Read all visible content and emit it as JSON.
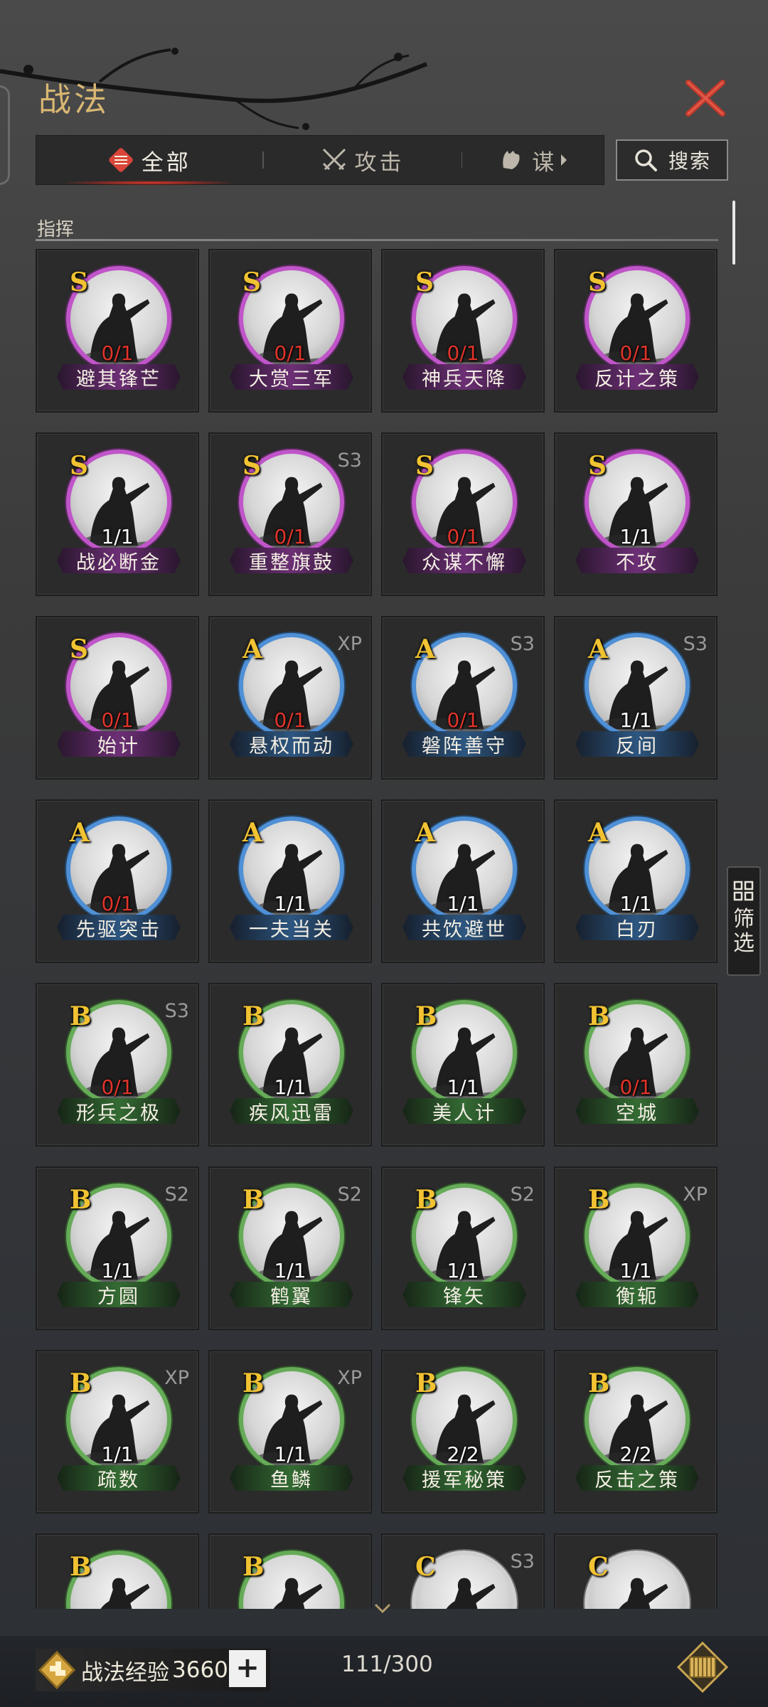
{
  "header": {
    "title": "战法"
  },
  "tabs": [
    {
      "label": "全部",
      "icon": "scroll-icon",
      "active": true
    },
    {
      "label": "攻击",
      "icon": "crossed-swords-icon",
      "active": false
    },
    {
      "label": "谋",
      "icon": "hand-icon",
      "active": false
    }
  ],
  "search": {
    "label": "搜索"
  },
  "section": {
    "label": "指挥"
  },
  "filter": {
    "label": "筛选"
  },
  "colors": {
    "s": "#c055c9",
    "a": "#4f90d6",
    "b": "#66ab58",
    "c": "#cfcfcf",
    "gold": "#d9b772",
    "red": "#e0342a"
  },
  "tactics": [
    {
      "grade": "S",
      "name": "避其锋芒",
      "count": "0/1",
      "tag": ""
    },
    {
      "grade": "S",
      "name": "大赏三军",
      "count": "0/1",
      "tag": ""
    },
    {
      "grade": "S",
      "name": "神兵天降",
      "count": "0/1",
      "tag": ""
    },
    {
      "grade": "S",
      "name": "反计之策",
      "count": "0/1",
      "tag": ""
    },
    {
      "grade": "S",
      "name": "战必断金",
      "count": "1/1",
      "tag": ""
    },
    {
      "grade": "S",
      "name": "重整旗鼓",
      "count": "0/1",
      "tag": "S3"
    },
    {
      "grade": "S",
      "name": "众谋不懈",
      "count": "0/1",
      "tag": ""
    },
    {
      "grade": "S",
      "name": "不攻",
      "count": "1/1",
      "tag": ""
    },
    {
      "grade": "S",
      "name": "始计",
      "count": "0/1",
      "tag": ""
    },
    {
      "grade": "A",
      "name": "悬权而动",
      "count": "0/1",
      "tag": "XP"
    },
    {
      "grade": "A",
      "name": "磐阵善守",
      "count": "0/1",
      "tag": "S3"
    },
    {
      "grade": "A",
      "name": "反间",
      "count": "1/1",
      "tag": "S3"
    },
    {
      "grade": "A",
      "name": "先驱突击",
      "count": "0/1",
      "tag": ""
    },
    {
      "grade": "A",
      "name": "一夫当关",
      "count": "1/1",
      "tag": ""
    },
    {
      "grade": "A",
      "name": "共饮避世",
      "count": "1/1",
      "tag": ""
    },
    {
      "grade": "A",
      "name": "白刃",
      "count": "1/1",
      "tag": ""
    },
    {
      "grade": "B",
      "name": "形兵之极",
      "count": "0/1",
      "tag": "S3"
    },
    {
      "grade": "B",
      "name": "疾风迅雷",
      "count": "1/1",
      "tag": ""
    },
    {
      "grade": "B",
      "name": "美人计",
      "count": "1/1",
      "tag": ""
    },
    {
      "grade": "B",
      "name": "空城",
      "count": "0/1",
      "tag": ""
    },
    {
      "grade": "B",
      "name": "方圆",
      "count": "1/1",
      "tag": "S2"
    },
    {
      "grade": "B",
      "name": "鹤翼",
      "count": "1/1",
      "tag": "S2"
    },
    {
      "grade": "B",
      "name": "锋矢",
      "count": "1/1",
      "tag": "S2"
    },
    {
      "grade": "B",
      "name": "衡轭",
      "count": "1/1",
      "tag": "XP"
    },
    {
      "grade": "B",
      "name": "疏数",
      "count": "1/1",
      "tag": "XP"
    },
    {
      "grade": "B",
      "name": "鱼鳞",
      "count": "1/1",
      "tag": "XP"
    },
    {
      "grade": "B",
      "name": "援军秘策",
      "count": "2/2",
      "tag": ""
    },
    {
      "grade": "B",
      "name": "反击之策",
      "count": "2/2",
      "tag": ""
    },
    {
      "grade": "B",
      "name": "",
      "count": "",
      "tag": ""
    },
    {
      "grade": "B",
      "name": "",
      "count": "",
      "tag": ""
    },
    {
      "grade": "C",
      "name": "",
      "count": "",
      "tag": "S3"
    },
    {
      "grade": "C",
      "name": "",
      "count": "",
      "tag": ""
    }
  ],
  "footer": {
    "exp_label": "战法经验",
    "exp_value": "3660",
    "plus_label": "+",
    "capacity": "111/300"
  }
}
